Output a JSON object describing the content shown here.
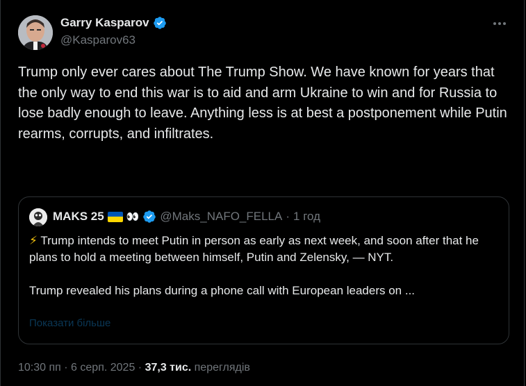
{
  "author": {
    "name": "Garry Kasparov",
    "handle": "@Kasparov63"
  },
  "tweet": {
    "text": "Trump only ever cares about The Trump Show. We have known for years that the only way to end this war is to aid and arm Ukraine to win and for Russia to lose badly enough to leave. Anything less is at best a postponement while Putin rearms, corrupts, and infiltrates."
  },
  "quote": {
    "name": "MAKS 25",
    "eyes": "👀",
    "handle": "@Maks_NAFO_FELLA",
    "separator": "·",
    "time": "1 год",
    "bolt": "⚡",
    "line1": "Trump intends to meet Putin in person as early as next week, and soon after that he plans to hold a meeting between himself, Putin and Zelensky, — NYT.",
    "line2": "Trump revealed his plans during a phone call with European leaders on ...",
    "show_more": "Показати більше"
  },
  "footer": {
    "time": "10:30 пп",
    "dot1": "·",
    "date": "6 серп. 2025",
    "dot2": "·",
    "views_count": "37,3 тис.",
    "views_label": "переглядів"
  },
  "colors": {
    "background": "#000000",
    "text": "#e7e9ea",
    "secondary": "#71767b",
    "accent": "#1d9bf0",
    "border": "#2f3336"
  },
  "icons": [
    "verified-badge-icon",
    "more-options-icon",
    "ukraine-flag-icon",
    "lightning-icon"
  ]
}
